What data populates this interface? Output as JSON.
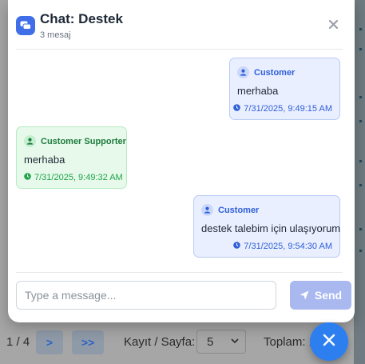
{
  "chat": {
    "title": "Chat: Destek",
    "subtitle": "3 mesaj",
    "close_icon": "close-icon",
    "messages": [
      {
        "sender": "Customer",
        "role": "customer",
        "text": "merhaba",
        "time": "7/31/2025, 9:49:15 AM"
      },
      {
        "sender": "Customer Supporter",
        "role": "support",
        "text": "merhaba",
        "time": "7/31/2025, 9:49:32 AM"
      },
      {
        "sender": "Customer",
        "role": "customer",
        "text": "destek talebim için ulaşıyorum",
        "time": "7/31/2025, 9:54:30 AM"
      }
    ],
    "input": {
      "placeholder": "Type a message...",
      "value": ""
    },
    "send_label": "Send"
  },
  "background": {
    "page_info": "1 / 4",
    "next_label": ">",
    "last_label": ">>",
    "per_page_label": "Kayıt / Sayfa:",
    "per_page_value": "5",
    "total_text": "Toplam: 1"
  },
  "colors": {
    "accent": "#3f6ee8",
    "customer_bubble": "#e9efff",
    "support_bubble": "#e6f9ea",
    "fab": "#2d7ff0"
  }
}
